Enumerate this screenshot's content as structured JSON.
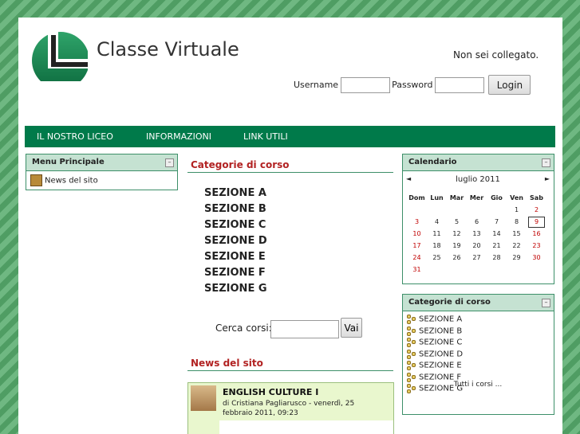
{
  "header": {
    "site_title": "Classe Virtuale",
    "login_status": "Non sei collegato.",
    "username_label": "Username",
    "password_label": "Password",
    "login_button": "Login"
  },
  "nav": [
    "IL NOSTRO LICEO",
    "INFORMAZIONI",
    "LINK UTILI"
  ],
  "menu_block": {
    "title": "Menu Principale",
    "items": [
      "News del sito"
    ]
  },
  "categories": {
    "title": "Categorie di corso",
    "items": [
      "SEZIONE A",
      "SEZIONE B",
      "SEZIONE C",
      "SEZIONE D",
      "SEZIONE E",
      "SEZIONE F",
      "SEZIONE G"
    ],
    "search_label": "Cerca corsi:",
    "search_button": "Vai"
  },
  "news": {
    "title": "News del sito",
    "post": {
      "title": "ENGLISH CULTURE I",
      "meta": "di Cristiana Pagliarusco - venerdì, 25 febbraio 2011, 09:23"
    }
  },
  "calendar": {
    "title": "Calendario",
    "month": "luglio 2011",
    "prev": "◄",
    "next": "►",
    "weekdays": [
      "Dom",
      "Lun",
      "Mar",
      "Mer",
      "Gio",
      "Ven",
      "Sab"
    ],
    "weeks": [
      [
        "",
        "",
        "",
        "",
        "",
        "1",
        "2"
      ],
      [
        "3",
        "4",
        "5",
        "6",
        "7",
        "8",
        "9"
      ],
      [
        "10",
        "11",
        "12",
        "13",
        "14",
        "15",
        "16"
      ],
      [
        "17",
        "18",
        "19",
        "20",
        "21",
        "22",
        "23"
      ],
      [
        "24",
        "25",
        "26",
        "27",
        "28",
        "29",
        "30"
      ],
      [
        "31",
        "",
        "",
        "",
        "",
        "",
        ""
      ]
    ],
    "today": "9"
  },
  "side_categories": {
    "title": "Categorie di corso",
    "items": [
      "SEZIONE A",
      "SEZIONE B",
      "SEZIONE C",
      "SEZIONE D",
      "SEZIONE E",
      "SEZIONE F",
      "SEZIONE G"
    ],
    "all_link": "Tutti i corsi ..."
  },
  "colors": {
    "nav_bg": "#007a4a",
    "block_header": "#c5e2d2",
    "section_title": "#b22222",
    "weekend": "#c00000"
  }
}
